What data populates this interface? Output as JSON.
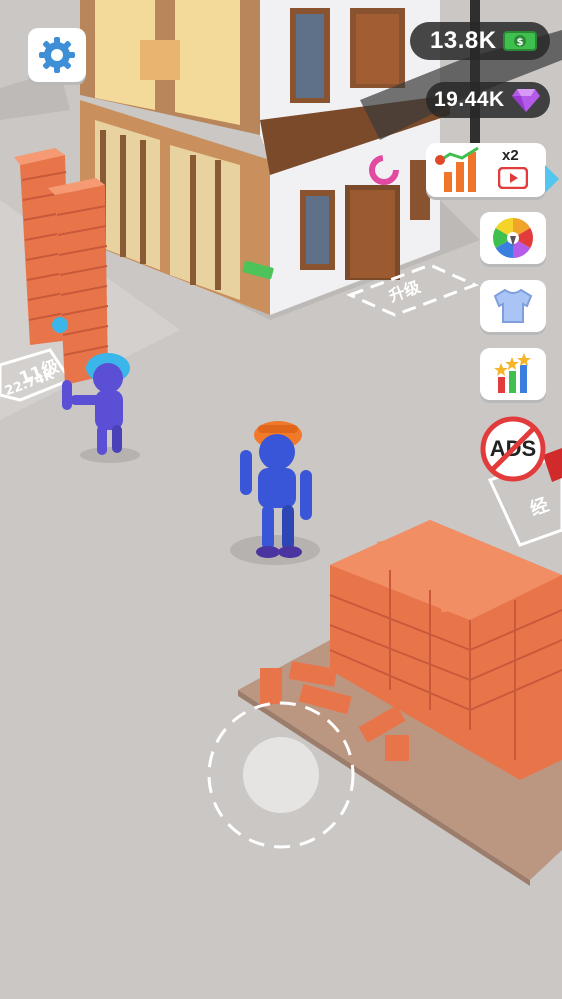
{
  "hud": {
    "cash": "13.8K",
    "gems": "19.44K",
    "income_boost_multiplier": "x2",
    "ads_label": "ADS"
  },
  "world": {
    "upgrade_pad_label": "升级",
    "worker_pad_label": "11级",
    "worker_pad_cost": "22.74K",
    "right_pad_label": "经"
  },
  "colors": {
    "brick": "#e8754a",
    "worker_body": "#5b4fd6",
    "player_body": "#3a56d8",
    "helmet_blue": "#3ab7e8",
    "helmet_orange": "#f07a2a",
    "cash_green": "#3fbf4d",
    "gem_purple": "#b55bea",
    "ads_red": "#e23b3b"
  },
  "icons": [
    "gear-icon",
    "cash-icon",
    "gem-icon",
    "income-boost-icon",
    "video-ad-icon",
    "spin-wheel-icon",
    "shirt-icon",
    "stats-icon",
    "no-ads-icon",
    "joystick"
  ]
}
